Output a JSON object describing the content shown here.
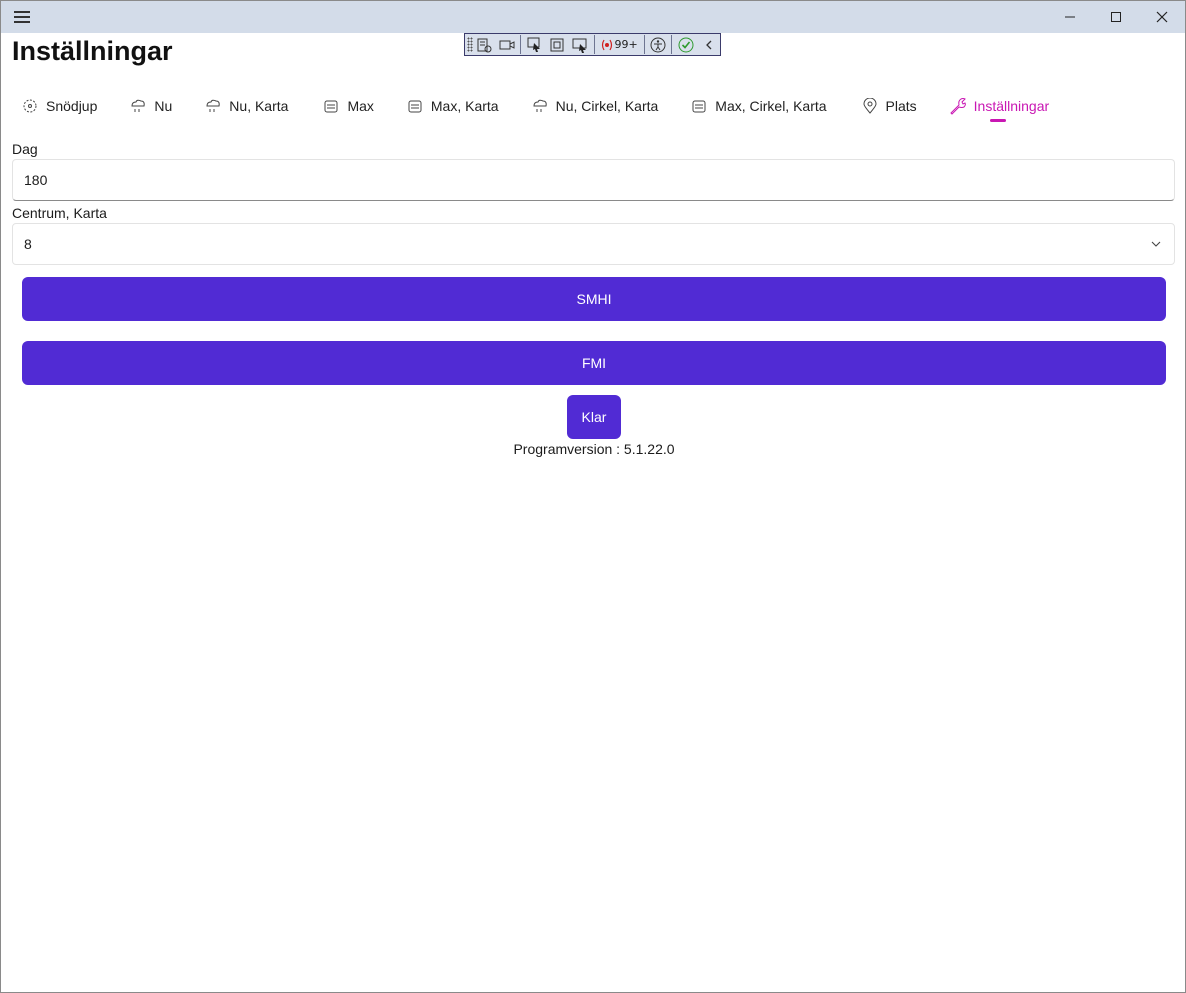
{
  "page": {
    "title": "Inställningar"
  },
  "devtoolbar": {
    "counter": "99+"
  },
  "tabs": [
    {
      "label": "Snödjup",
      "icon": "snowflake-icon"
    },
    {
      "label": "Nu",
      "icon": "cloud-snow-icon"
    },
    {
      "label": "Nu, Karta",
      "icon": "cloud-snow-icon"
    },
    {
      "label": "Max",
      "icon": "snow-gauge-icon"
    },
    {
      "label": "Max, Karta",
      "icon": "snow-gauge-icon"
    },
    {
      "label": "Nu, Cirkel, Karta",
      "icon": "cloud-snow-icon"
    },
    {
      "label": "Max, Cirkel, Karta",
      "icon": "snow-gauge-icon"
    },
    {
      "label": "Plats",
      "icon": "location-pin-icon"
    },
    {
      "label": "Inställningar",
      "icon": "wrench-icon",
      "active": true
    }
  ],
  "form": {
    "dag_label": "Dag",
    "dag_value": "180",
    "centrum_label": "Centrum, Karta",
    "centrum_value": "8"
  },
  "buttons": {
    "smhi": "SMHI",
    "fmi": "FMI",
    "klar": "Klar"
  },
  "version": "Programversion : 5.1.22.0",
  "colors": {
    "accent": "#512bd4",
    "active_tab": "#c917b3",
    "titlebar": "#d3dce9"
  }
}
